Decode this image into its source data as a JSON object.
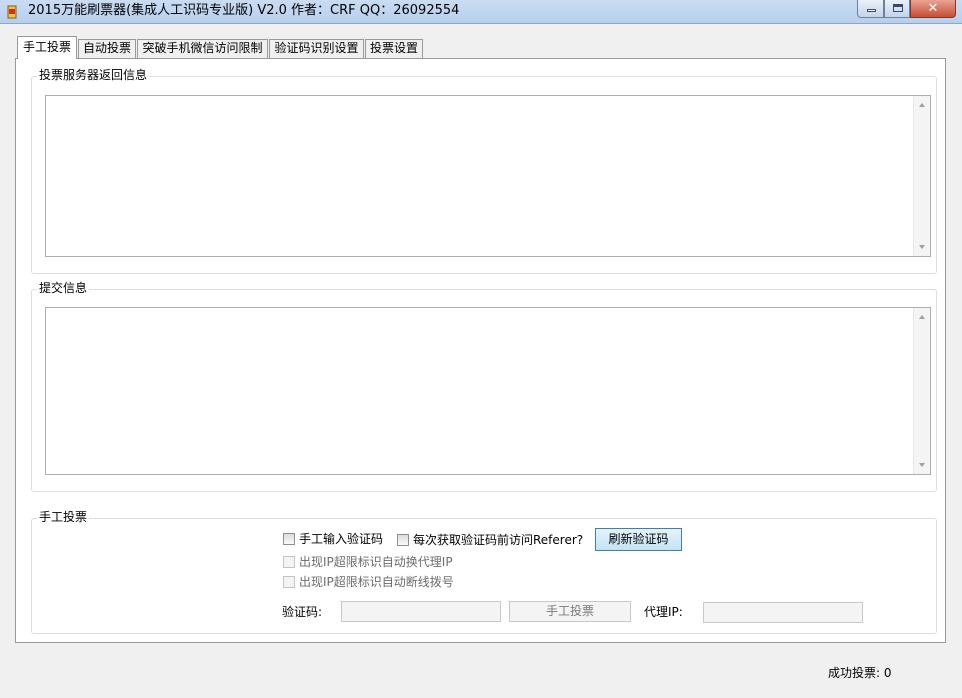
{
  "window": {
    "title": "2015万能刷票器(集成人工识码专业版) V2.0  作者：CRF QQ：26092554",
    "close_label": "✕"
  },
  "tabs": [
    {
      "label": "手工投票",
      "active": true
    },
    {
      "label": "自动投票",
      "active": false
    },
    {
      "label": "突破手机微信访问限制",
      "active": false
    },
    {
      "label": "验证码识别设置",
      "active": false
    },
    {
      "label": "投票设置",
      "active": false
    }
  ],
  "server_response": {
    "label": "投票服务器返回信息",
    "content": ""
  },
  "submit_info": {
    "label": "提交信息",
    "content": ""
  },
  "manual_vote": {
    "label": "手工投票",
    "manual_captcha_checkbox": {
      "label": "手工输入验证码",
      "checked": false
    },
    "referer_checkbox": {
      "label": "每次获取验证码前访问Referer?",
      "checked": false
    },
    "refresh_captcha_button": "刷新验证码",
    "auto_proxy_checkbox": {
      "label": "出现IP超限标识自动换代理IP",
      "checked": false,
      "enabled": false
    },
    "auto_redial_checkbox": {
      "label": "出现IP超限标识自动断线拨号",
      "checked": false,
      "enabled": false
    },
    "captcha_label": "验证码:",
    "captcha_value": "",
    "vote_button": "手工投票",
    "proxy_label": "代理IP:",
    "proxy_value": ""
  },
  "status": {
    "success_votes": "成功投票: 0"
  },
  "colors": {
    "accent": "#3c7fb1",
    "titlebar": "#c9dcf2",
    "close": "#c74e35"
  }
}
